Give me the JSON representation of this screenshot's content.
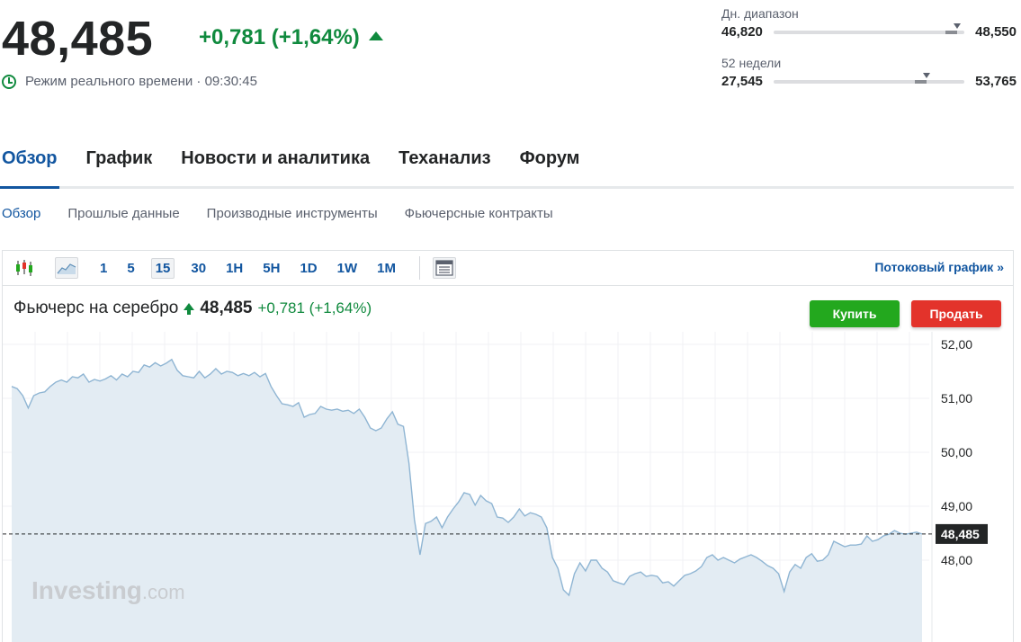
{
  "quote": {
    "price": "48,485",
    "change": "+0,781 (+1,64%)",
    "realtime": "Режим реального времени · 09:30:45"
  },
  "ranges": {
    "daily": {
      "title": "Дн. диапазон",
      "low": "46,820",
      "high": "48,550",
      "marker": 0.96
    },
    "weeks52": {
      "title": "52 недели",
      "low": "27,545",
      "high": "53,765",
      "marker": 0.8
    }
  },
  "tabs": [
    "Обзор",
    "График",
    "Новости и аналитика",
    "Теханализ",
    "Форум"
  ],
  "subtabs": [
    "Обзор",
    "Прошлые данные",
    "Производные инструменты",
    "Фьючерсные контракты"
  ],
  "toolbar": {
    "intervals": [
      "1",
      "5",
      "15",
      "30",
      "1H",
      "5H",
      "1D",
      "1W",
      "1M"
    ],
    "active_interval": "15",
    "stream_link": "Потоковый график »"
  },
  "instrument": {
    "name": "Фьючерс на серебро",
    "price": "48,485",
    "change": "+0,781 (+1,64%)"
  },
  "buttons": {
    "buy": "Купить",
    "sell": "Продать"
  },
  "watermark": {
    "brand": "Investing",
    "suffix": ".com"
  },
  "colors": {
    "up": "#108a3e",
    "link": "#1256a0",
    "line": "#8fb5d3",
    "area": "#e3ecf3",
    "buy": "#23a81e",
    "sell": "#e3332b"
  },
  "chart_data": {
    "type": "area",
    "y_ticks": [
      "52,00",
      "51,00",
      "50,00",
      "49,00",
      "48,00"
    ],
    "ylim": [
      46.9,
      52.3
    ],
    "last_label": "48,485",
    "last_value": 48.485,
    "series": [
      {
        "values": [
          51.22,
          51.18,
          51.05,
          50.82,
          51.05,
          51.1,
          51.12,
          51.22,
          51.3,
          51.34,
          51.3,
          51.4,
          51.38,
          51.45,
          51.3,
          51.35,
          51.32,
          51.36,
          51.42,
          51.34,
          51.45,
          51.4,
          51.5,
          51.48,
          51.62,
          51.58,
          51.66,
          51.6,
          51.65,
          51.72,
          51.52,
          51.42,
          51.4,
          51.38,
          51.5,
          51.38,
          51.45,
          51.55,
          51.45,
          51.5,
          51.48,
          51.42,
          51.46,
          51.42,
          51.48,
          51.4,
          51.46,
          51.22,
          51.05,
          50.9,
          50.88,
          50.85,
          50.92,
          50.65,
          50.7,
          50.72,
          50.85,
          50.8,
          50.78,
          50.8,
          50.76,
          50.78,
          50.72,
          50.8,
          50.65,
          50.45,
          50.4,
          50.45,
          50.62,
          50.75,
          50.52,
          50.48,
          49.8,
          48.75,
          48.1,
          48.68,
          48.72,
          48.8,
          48.6,
          48.8,
          48.95,
          49.08,
          49.25,
          49.22,
          49.02,
          49.2,
          49.1,
          49.05,
          48.8,
          48.78,
          48.7,
          48.8,
          48.95,
          48.82,
          48.88,
          48.85,
          48.8,
          48.6,
          48.05,
          47.85,
          47.45,
          47.35,
          47.75,
          47.95,
          47.8,
          48.0,
          48.0,
          47.85,
          47.78,
          47.62,
          47.58,
          47.55,
          47.7,
          47.75,
          47.78,
          47.7,
          47.72,
          47.7,
          47.58,
          47.6,
          47.52,
          47.62,
          47.72,
          47.75,
          47.8,
          47.88,
          48.05,
          48.1,
          48.0,
          48.05,
          48.0,
          47.95,
          48.02,
          48.06,
          48.1,
          48.05,
          47.98,
          47.9,
          47.85,
          47.75,
          47.42,
          47.78,
          47.92,
          47.85,
          48.05,
          48.12,
          47.98,
          48.0,
          48.1,
          48.35,
          48.3,
          48.25,
          48.28,
          48.28,
          48.3,
          48.45,
          48.35,
          48.38,
          48.45,
          48.48,
          48.55,
          48.5,
          48.48,
          48.5,
          48.52,
          48.485
        ]
      }
    ],
    "grid": true
  }
}
